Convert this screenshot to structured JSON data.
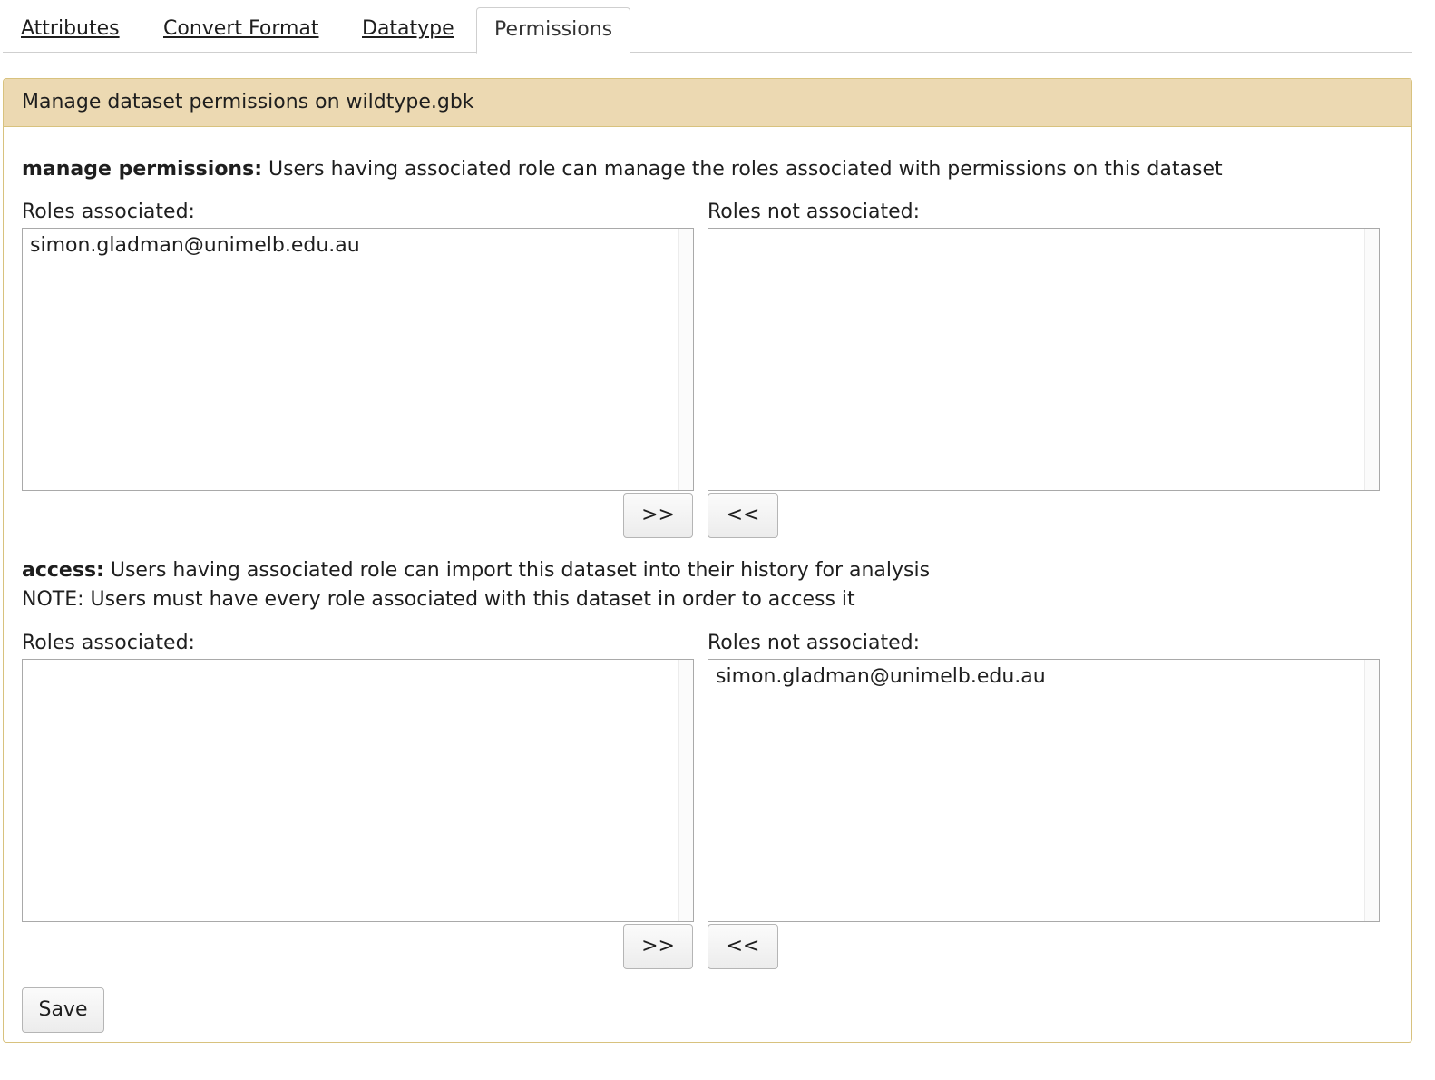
{
  "tabs": [
    {
      "label": "Attributes"
    },
    {
      "label": "Convert Format"
    },
    {
      "label": "Datatype"
    },
    {
      "label": "Permissions"
    }
  ],
  "panel": {
    "title": "Manage dataset permissions on wildtype.gbk"
  },
  "manage": {
    "name": "manage permissions:",
    "description": " Users having associated role can manage the roles associated with permissions on this dataset",
    "associated_label": "Roles associated:",
    "not_associated_label": "Roles not associated:",
    "associated_roles": [
      "simon.gladman@unimelb.edu.au"
    ],
    "not_associated_roles": [],
    "add_label": ">>",
    "remove_label": "<<"
  },
  "access": {
    "name": "access:",
    "description": " Users having associated role can import this dataset into their history for analysis",
    "note": "NOTE: Users must have every role associated with this dataset in order to access it",
    "associated_label": "Roles associated:",
    "not_associated_label": "Roles not associated:",
    "associated_roles": [],
    "not_associated_roles": [
      "simon.gladman@unimelb.edu.au"
    ],
    "add_label": ">>",
    "remove_label": "<<"
  },
  "save_label": "Save"
}
